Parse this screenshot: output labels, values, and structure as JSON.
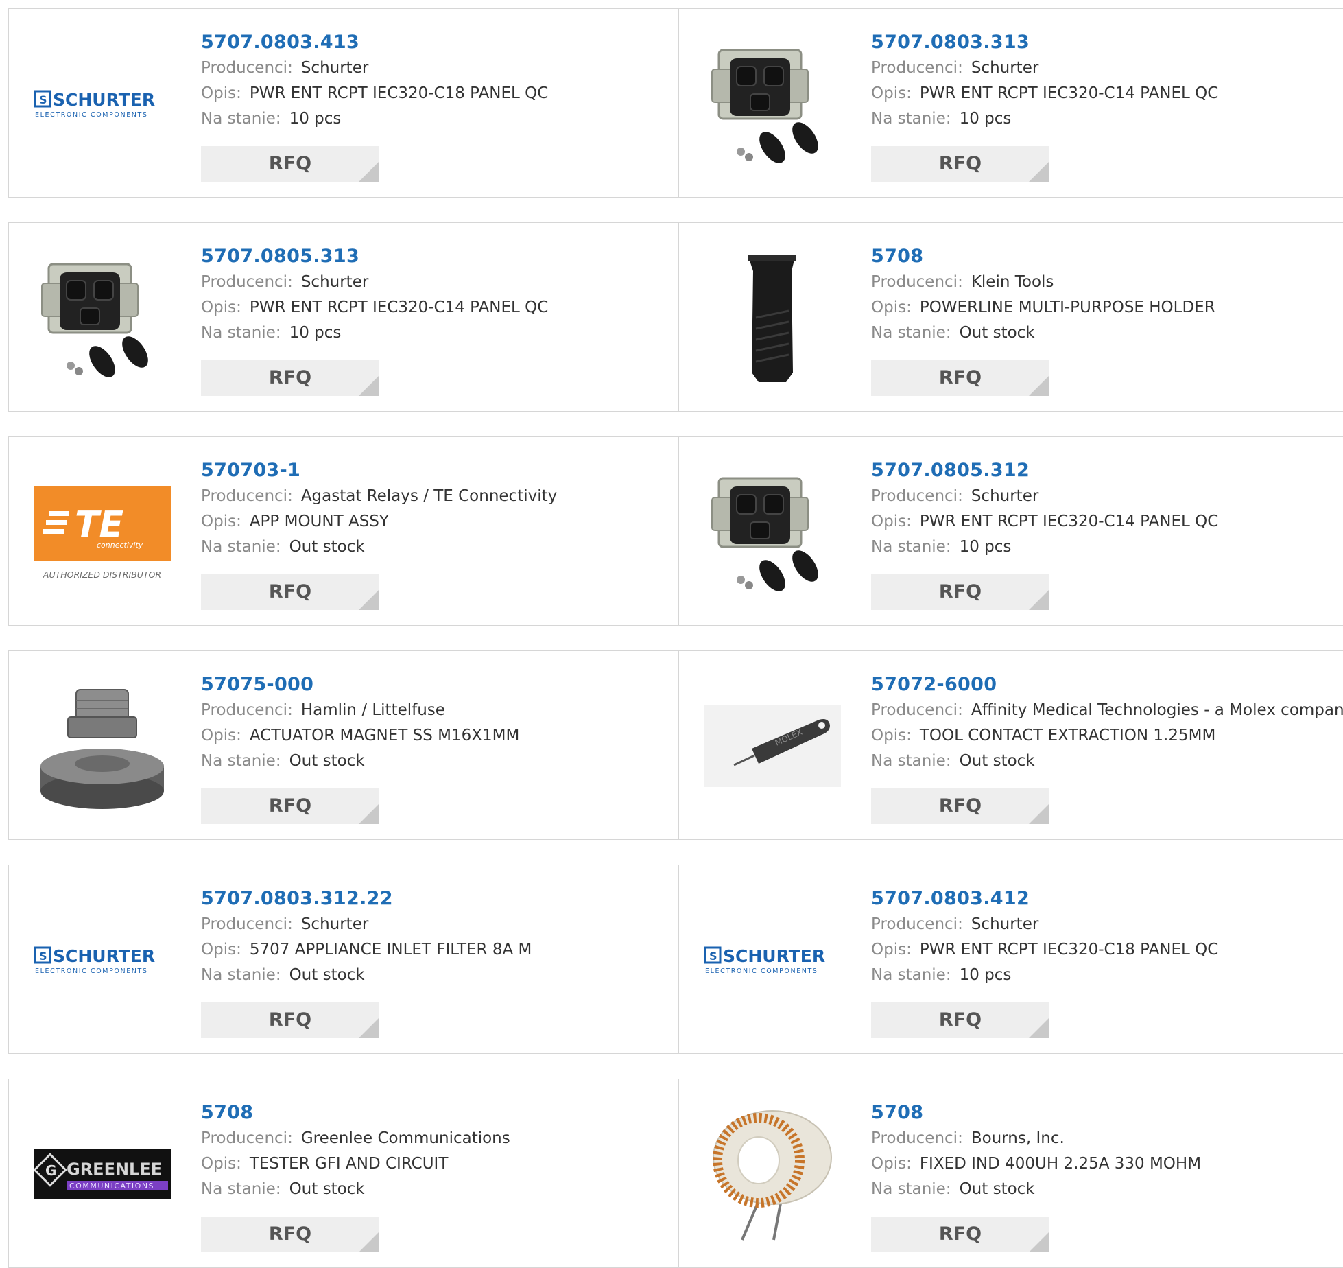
{
  "labels": {
    "manufacturer": "Producenci:",
    "description": "Opis:",
    "stock": "Na stanie:",
    "rfq": "RFQ"
  },
  "brand_text": {
    "schurter": "SCHURTER",
    "schurter_sub": "ELECTRONIC COMPONENTS",
    "te": "TE",
    "te_sub": "connectivity",
    "te_authorized": "AUTHORIZED DISTRIBUTOR",
    "greenlee": "GREENLEE",
    "greenlee_sub": "COMMUNICATIONS",
    "molex": "MOLEX"
  },
  "colors": {
    "part_link": "#1f6db5",
    "schurter_blue": "#1a62b0",
    "te_orange": "#f28c28",
    "greenlee_purple": "#7b3fc4"
  },
  "products": [
    {
      "part": "5707.0803.413",
      "manufacturer": "Schurter",
      "description": "PWR ENT RCPT IEC320-C18 PANEL QC",
      "stock": "10 pcs",
      "image": "schurter-logo"
    },
    {
      "part": "5707.0803.313",
      "manufacturer": "Schurter",
      "description": "PWR ENT RCPT IEC320-C14 PANEL QC",
      "stock": "10 pcs",
      "image": "power-entry-module"
    },
    {
      "part": "5707.0805.313",
      "manufacturer": "Schurter",
      "description": "PWR ENT RCPT IEC320-C14 PANEL QC",
      "stock": "10 pcs",
      "image": "power-entry-module"
    },
    {
      "part": "5708",
      "manufacturer": "Klein Tools",
      "description": "POWERLINE MULTI-PURPOSE HOLDER",
      "stock": "Out stock",
      "image": "tool-holder"
    },
    {
      "part": "570703-1",
      "manufacturer": "Agastat Relays / TE Connectivity",
      "description": "APP MOUNT ASSY",
      "stock": "Out stock",
      "image": "te-logo"
    },
    {
      "part": "5707.0805.312",
      "manufacturer": "Schurter",
      "description": "PWR ENT RCPT IEC320-C14 PANEL QC",
      "stock": "10 pcs",
      "image": "power-entry-module"
    },
    {
      "part": "57075-000",
      "manufacturer": "Hamlin / Littelfuse",
      "description": "ACTUATOR MAGNET SS M16X1MM",
      "stock": "Out stock",
      "image": "actuator-magnet"
    },
    {
      "part": "57072-6000",
      "manufacturer": "Affinity Medical Technologies - a Molex company",
      "description": "TOOL CONTACT EXTRACTION 1.25MM",
      "stock": "Out stock",
      "image": "extraction-tool"
    },
    {
      "part": "5707.0803.312.22",
      "manufacturer": "Schurter",
      "description": "5707 APPLIANCE INLET FILTER 8A M",
      "stock": "Out stock",
      "image": "schurter-logo"
    },
    {
      "part": "5707.0803.412",
      "manufacturer": "Schurter",
      "description": "PWR ENT RCPT IEC320-C18 PANEL QC",
      "stock": "10 pcs",
      "image": "schurter-logo"
    },
    {
      "part": "5708",
      "manufacturer": "Greenlee Communications",
      "description": "TESTER GFI AND CIRCUIT",
      "stock": "Out stock",
      "image": "greenlee-logo"
    },
    {
      "part": "5708",
      "manufacturer": "Bourns, Inc.",
      "description": "FIXED IND 400UH 2.25A 330 MOHM",
      "stock": "Out stock",
      "image": "toroid-inductor"
    }
  ]
}
